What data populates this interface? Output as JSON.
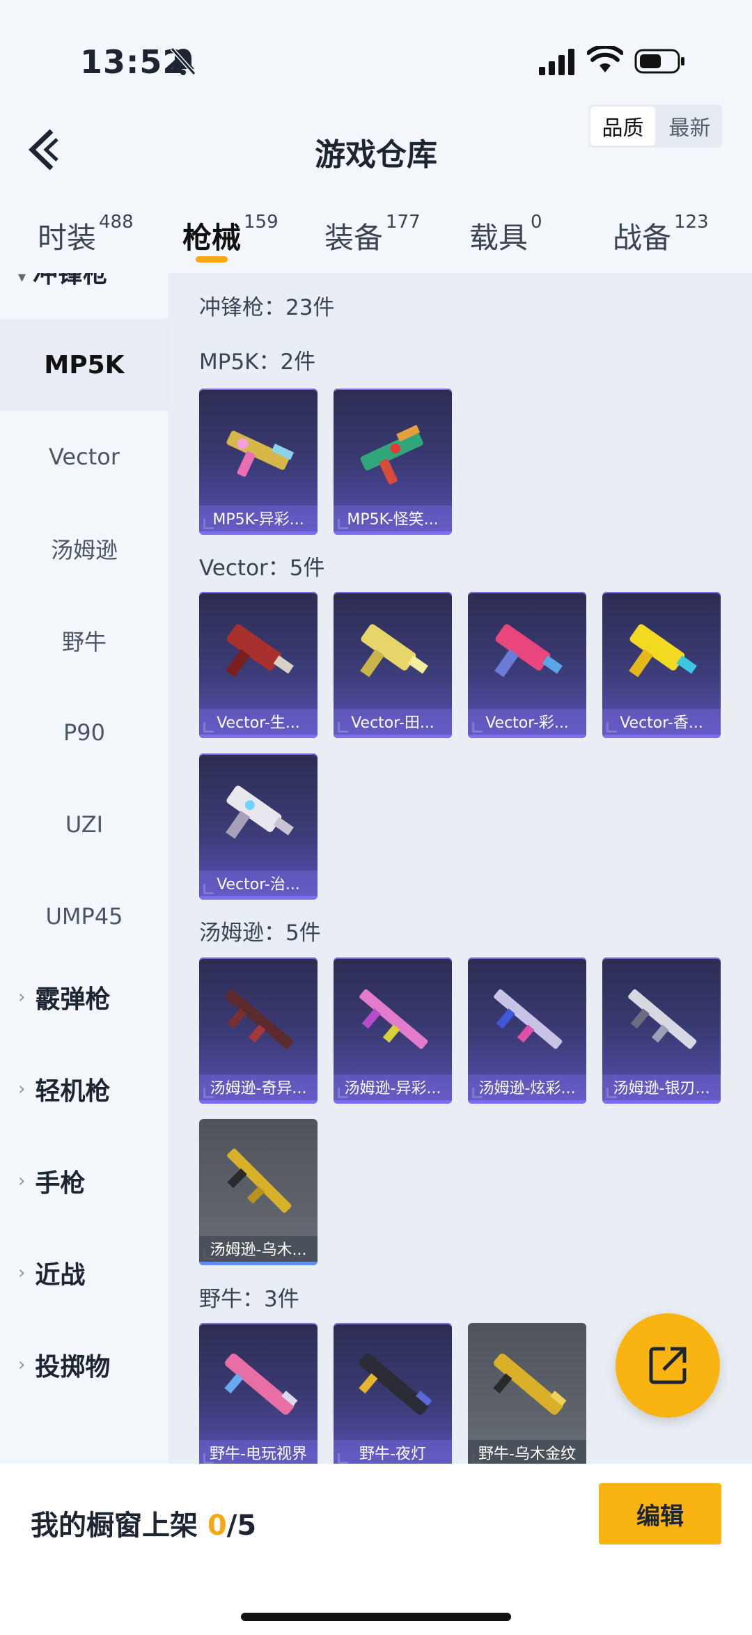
{
  "status": {
    "time": "13:52"
  },
  "header": {
    "title": "游戏仓库",
    "sort": [
      "品质",
      "最新"
    ]
  },
  "tabs": [
    {
      "label": "时装",
      "count": "488"
    },
    {
      "label": "枪械",
      "count": "159"
    },
    {
      "label": "装备",
      "count": "177"
    },
    {
      "label": "载具",
      "count": "0"
    },
    {
      "label": "战备",
      "count": "123"
    }
  ],
  "sidebar": {
    "partial": "冲锋枪",
    "items": [
      "MP5K",
      "Vector",
      "汤姆逊",
      "野牛",
      "P90",
      "UZI",
      "UMP45"
    ],
    "groups": [
      "霰弹枪",
      "轻机枪",
      "手枪",
      "近战",
      "投掷物"
    ]
  },
  "main": {
    "summary": "冲锋枪：23件",
    "sections": [
      {
        "title": "MP5K：2件",
        "items": [
          "MP5K-异彩...",
          "MP5K-怪笑..."
        ]
      },
      {
        "title": "Vector：5件",
        "items": [
          "Vector-生...",
          "Vector-田...",
          "Vector-彩...",
          "Vector-香...",
          "Vector-治..."
        ]
      },
      {
        "title": "汤姆逊：5件",
        "items": [
          "汤姆逊-奇异...",
          "汤姆逊-异彩...",
          "汤姆逊-炫彩...",
          "汤姆逊-银刃...",
          "汤姆逊-乌木..."
        ]
      },
      {
        "title": "野牛：3件",
        "items": [
          "野牛-电玩视界",
          "野牛-夜灯",
          "野牛-乌木金纹"
        ]
      }
    ]
  },
  "footer": {
    "label": "我的橱窗上架 ",
    "count": "0",
    "total": "/5",
    "edit": "编辑"
  },
  "colors": {
    "accent": "#f9b412",
    "card": "#3c3c78"
  }
}
